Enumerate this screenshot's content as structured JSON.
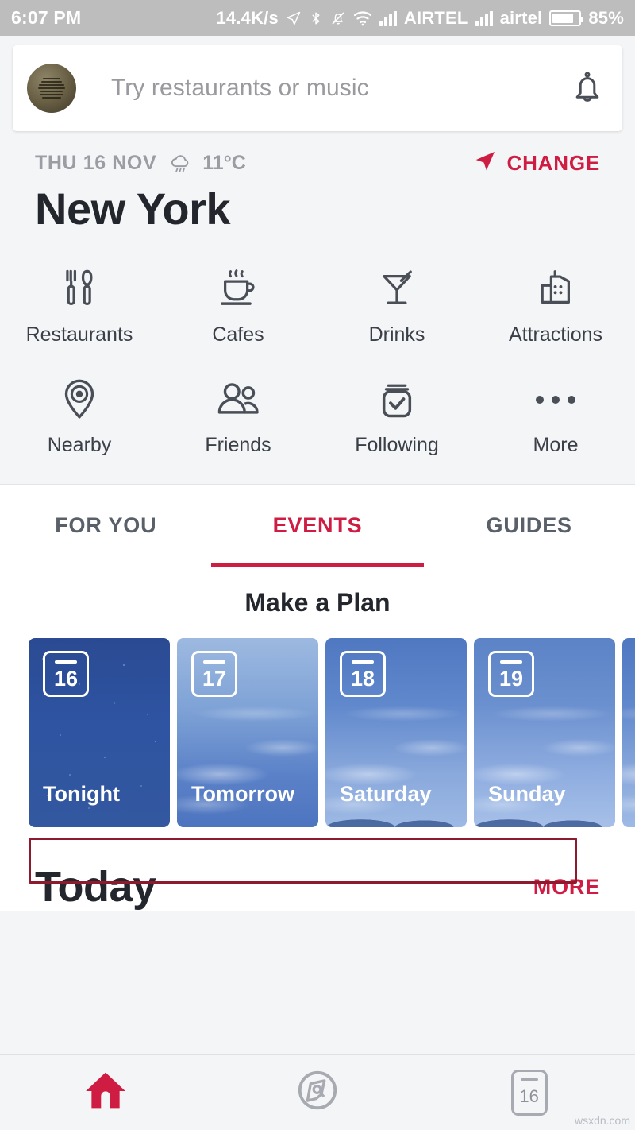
{
  "statusbar": {
    "time": "6:07 PM",
    "network_speed": "14.4K/s",
    "carrier_1": "AIRTEL",
    "carrier_2": "airtel",
    "battery": "85%",
    "icons": [
      "location-arrow-icon",
      "bluetooth-icon",
      "mute-bell-icon",
      "wifi-icon",
      "signal-bars-icon",
      "battery-icon"
    ]
  },
  "search": {
    "placeholder": "Try restaurants or music",
    "avatar_name": "user-avatar",
    "bell_name": "notification-bell-icon"
  },
  "location": {
    "date": "THU 16 NOV",
    "temperature": "11°C",
    "weather_icon": "rain-cloud-icon",
    "change_label": "CHANGE",
    "change_icon": "navigation-arrow-icon",
    "city": "New York"
  },
  "categories": [
    {
      "label": "Restaurants",
      "icon": "fork-knife-icon"
    },
    {
      "label": "Cafes",
      "icon": "coffee-cup-icon"
    },
    {
      "label": "Drinks",
      "icon": "cocktail-glass-icon"
    },
    {
      "label": "Attractions",
      "icon": "buildings-icon"
    },
    {
      "label": "Nearby",
      "icon": "map-pin-target-icon"
    },
    {
      "label": "Friends",
      "icon": "people-icon"
    },
    {
      "label": "Following",
      "icon": "bookmark-check-icon"
    },
    {
      "label": "More",
      "icon": "ellipsis-icon"
    }
  ],
  "tabs": [
    {
      "label": "FOR YOU",
      "active": false
    },
    {
      "label": "EVENTS",
      "active": true
    },
    {
      "label": "GUIDES",
      "active": false
    }
  ],
  "plan": {
    "title": "Make a Plan",
    "cards": [
      {
        "day_number": "16",
        "label": "Tonight",
        "theme": "night"
      },
      {
        "day_number": "17",
        "label": "Tomorrow",
        "theme": "day1"
      },
      {
        "day_number": "18",
        "label": "Saturday",
        "theme": "day2"
      },
      {
        "day_number": "19",
        "label": "Sunday",
        "theme": "day3"
      }
    ]
  },
  "today": {
    "title": "Today",
    "more_label": "MORE"
  },
  "bottom_nav": [
    {
      "icon": "home-icon",
      "active": true
    },
    {
      "icon": "explore-compass-icon",
      "active": false
    },
    {
      "icon": "calendar-icon",
      "day_number": "16",
      "active": false
    }
  ],
  "watermark": "wsxdn.com",
  "colors": {
    "accent": "#cf1c42",
    "annotation": "#8e1a2e",
    "background": "#f4f5f7",
    "statusbar": "#bdbdbd",
    "text_dark": "#23262c",
    "text_muted": "#9b9da3"
  }
}
